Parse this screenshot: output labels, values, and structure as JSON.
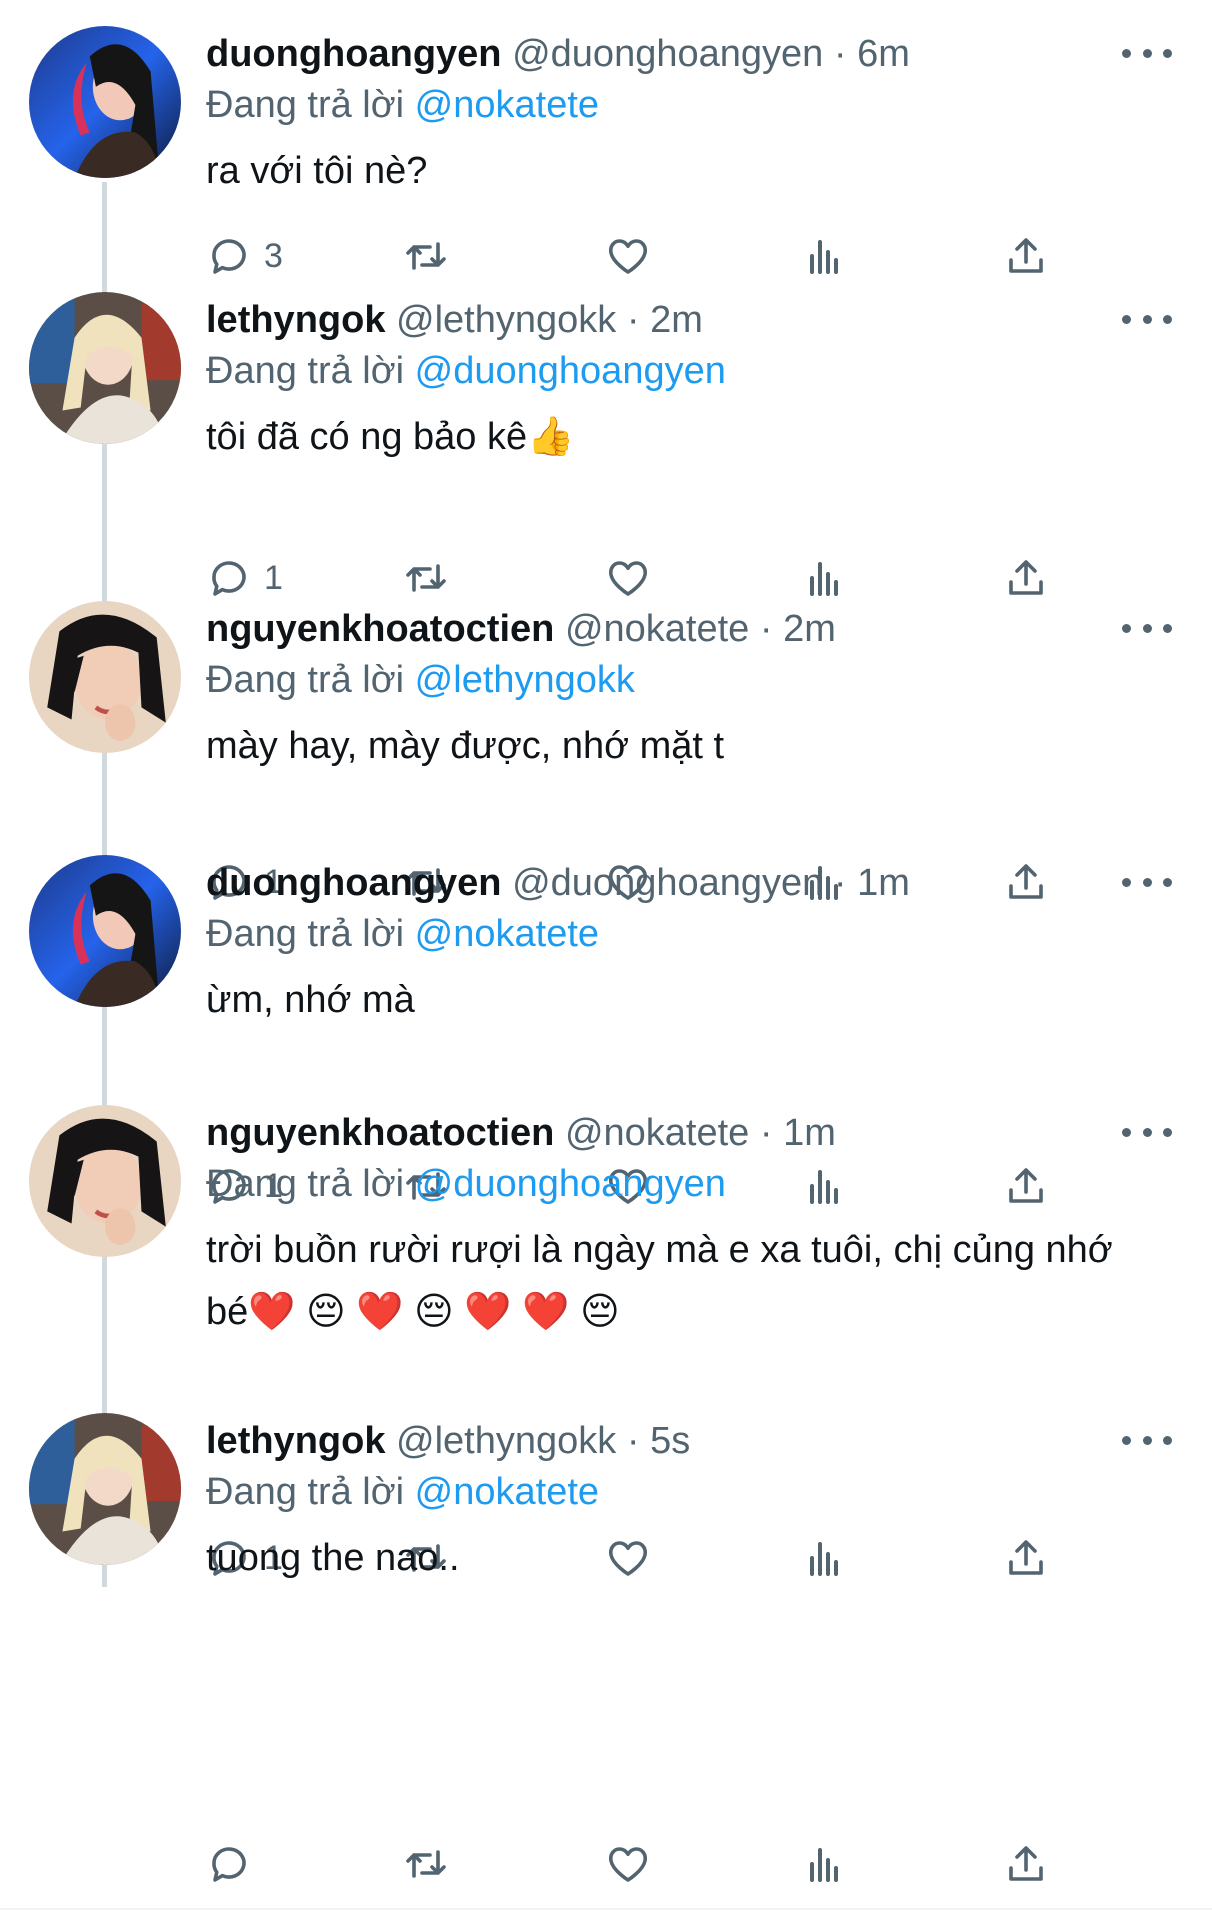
{
  "colors": {
    "accent": "#1d9bf0",
    "secondary_text": "#536471",
    "thread_line": "#cfd9de"
  },
  "reply_prefix": "Đang trả lời",
  "tweets": [
    {
      "name": "duonghoangyen",
      "handle": "@duonghoangyen",
      "time": "6m",
      "reply_to": "@nokatete",
      "text": "ra với tôi nè?",
      "reply_count": "3",
      "avatar": "avatar-duonghoangyen"
    },
    {
      "name": "lethyngok",
      "handle": "@lethyngokk",
      "time": "2m",
      "reply_to": "@duonghoangyen",
      "text": "tôi đã có ng bảo kê👍",
      "reply_count": "1",
      "avatar": "avatar-lethyngok"
    },
    {
      "name": "nguyenkhoatoctien",
      "handle": "@nokatete",
      "time": "2m",
      "reply_to": "@lethyngokk",
      "text": "mày hay, mày được, nhớ mặt t",
      "reply_count": "1",
      "avatar": "avatar-nguyenkhoatoctien"
    },
    {
      "name": "duonghoangyen",
      "handle": "@duonghoangyen",
      "time": "1m",
      "reply_to": "@nokatete",
      "text": "ừm, nhớ mà",
      "reply_count": "1",
      "avatar": "avatar-duonghoangyen"
    },
    {
      "name": "nguyenkhoatoctien",
      "handle": "@nokatete",
      "time": "1m",
      "reply_to": "@duonghoangyen",
      "text": "trời buồn rười rượi là ngày mà e xa tuôi, chị củng nhớ bé❤️ 😔 ❤️ 😔 ❤️ ❤️ 😔",
      "reply_count": "1",
      "avatar": "avatar-nguyenkhoatoctien"
    },
    {
      "name": "lethyngok",
      "handle": "@lethyngokk",
      "time": "5s",
      "reply_to": "@nokatete",
      "text": "tuong the nao..",
      "reply_count": "",
      "avatar": "avatar-lethyngok"
    }
  ]
}
